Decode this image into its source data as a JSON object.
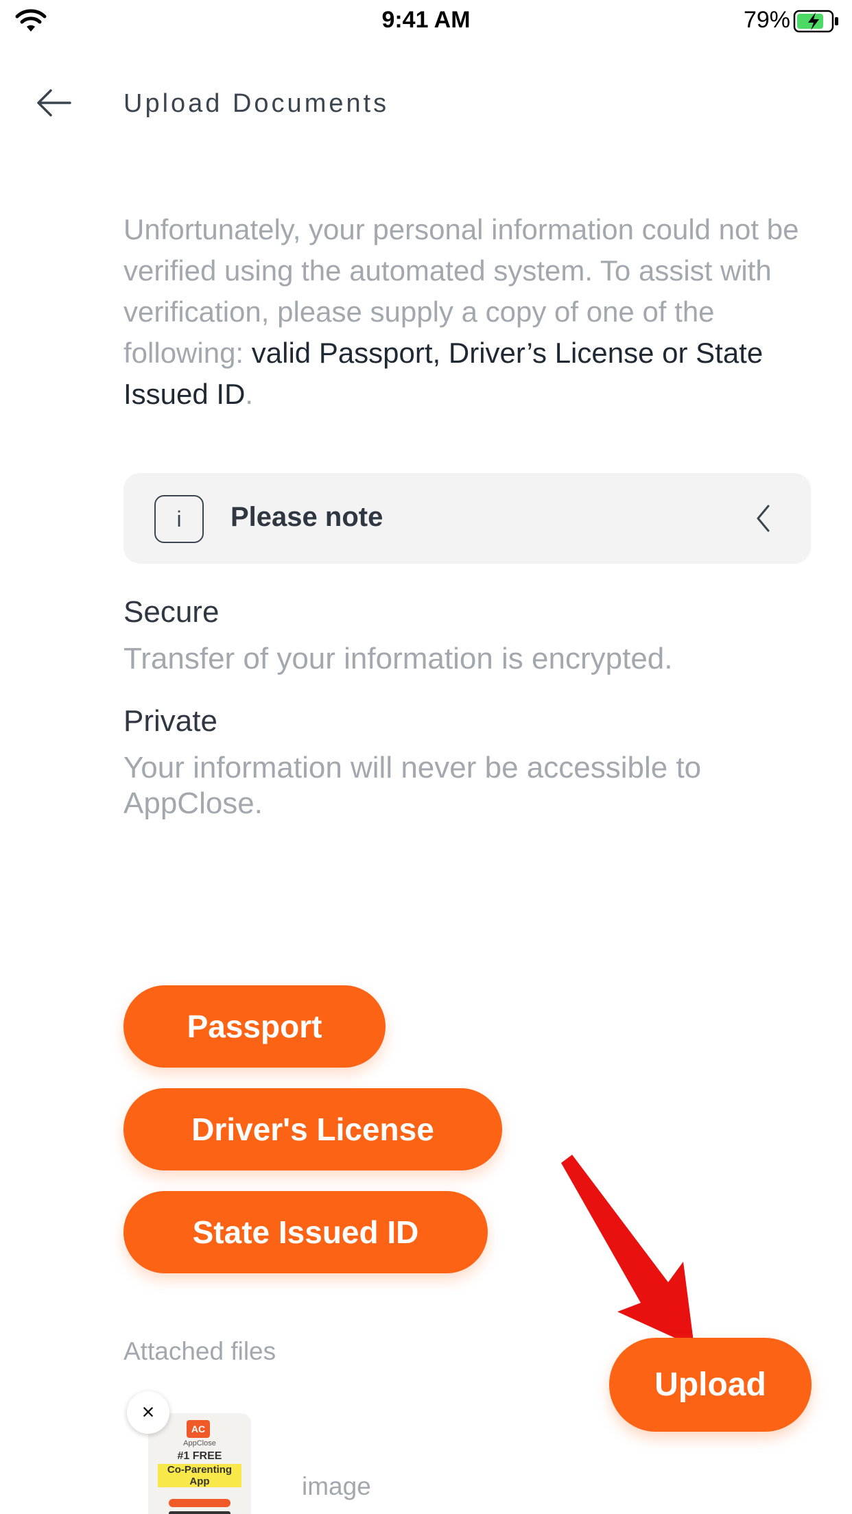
{
  "status_bar": {
    "time": "9:41 AM",
    "battery_percent": "79%",
    "wifi_icon": "wifi-icon",
    "battery_icon": "battery-charging-icon"
  },
  "header": {
    "back_icon": "arrow-left-icon",
    "title": "Upload Documents"
  },
  "intro": {
    "text": "Unfortunately, your personal information could not be verified using the automated system.  To assist with verification, please supply a copy of one of the following: ",
    "highlight": "valid Passport, Driver’s License or State Issued ID",
    "end": "."
  },
  "note": {
    "icon": "info-icon",
    "icon_glyph": "i",
    "label": "Please note",
    "chevron_icon": "chevron-left-icon"
  },
  "info": [
    {
      "title": "Secure",
      "text": "Transfer of your information is encrypted."
    },
    {
      "title": "Private",
      "text": "Your information will never be accessible to AppClose."
    }
  ],
  "document_buttons": [
    "Passport",
    "Driver's License",
    "State Issued ID"
  ],
  "attached": {
    "label": "Attached files",
    "file_name": "image",
    "remove_glyph": "×",
    "thumbnail": {
      "logo": "AC",
      "brand": "AppClose",
      "line1": "#1 FREE",
      "line2": "Co-Parenting App"
    }
  },
  "upload_button": "Upload",
  "colors": {
    "accent": "#fd6315",
    "annotation_arrow": "#e8110f",
    "muted_text": "#a2a8ae",
    "dark_text": "#2f3842",
    "note_background": "#f3f3f4"
  }
}
